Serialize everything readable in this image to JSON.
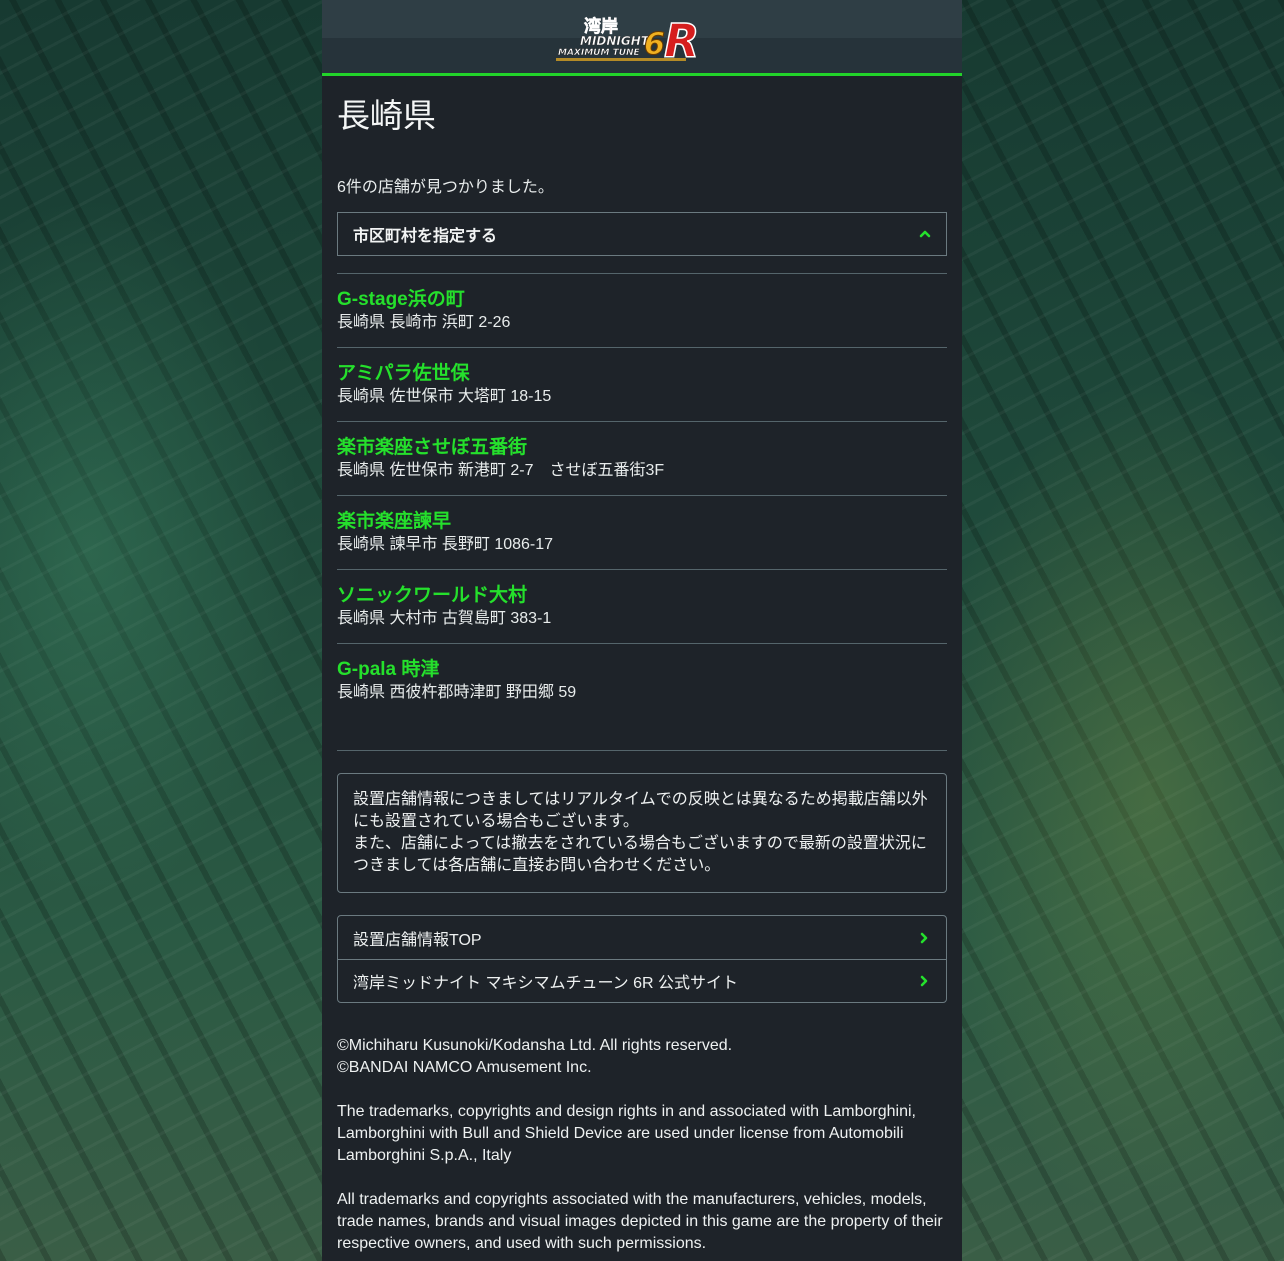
{
  "header": {
    "logo_text_top": "湾岸",
    "logo_text_mid": "MIDNIGHT",
    "logo_text_bottom": "MAXIMUM TUNE",
    "logo_letters": "6R"
  },
  "page": {
    "title": "長崎県",
    "result_count": "6件の店舗が見つかりました。",
    "city_filter_label": "市区町村を指定する"
  },
  "stores": [
    {
      "name": "G-stage浜の町",
      "address": "長崎県 長崎市 浜町 2-26"
    },
    {
      "name": "アミパラ佐世保",
      "address": "長崎県 佐世保市 大塔町 18-15"
    },
    {
      "name": "楽市楽座させぼ五番街",
      "address": "長崎県 佐世保市 新港町 2-7　させぼ五番街3F"
    },
    {
      "name": "楽市楽座諫早",
      "address": "長崎県 諫早市 長野町 1086-17"
    },
    {
      "name": "ソニックワールド大村",
      "address": "長崎県 大村市 古賀島町 383-1"
    },
    {
      "name": "G-pala 時津",
      "address": "長崎県 西彼杵郡時津町 野田郷 59"
    }
  ],
  "notice": {
    "line1": "設置店舗情報につきましてはリアルタイムでの反映とは異なるため掲載店舗以外にも設置されている場合もございます。",
    "line2": "また、店舗によっては撤去をされている場合もございますので最新の設置状況につきましては各店舗に直接お問い合わせください。"
  },
  "links": [
    {
      "label": "設置店舗情報TOP"
    },
    {
      "label": "湾岸ミッドナイト マキシマムチューン 6R 公式サイト"
    }
  ],
  "footer": {
    "copyright1": "©Michiharu Kusunoki/Kodansha Ltd. All rights reserved.",
    "copyright2": "©BANDAI NAMCO Amusement Inc.",
    "lamborghini": "The trademarks, copyrights and design rights in and associated with Lamborghini, Lamborghini with Bull and Shield Device are used under license from Automobili Lamborghini S.p.A., Italy",
    "trademarks": "All trademarks and copyrights associated with the manufacturers, vehicles, models, trade names, brands and visual images depicted in this game are the property of their respective owners, and used with such permissions."
  },
  "colors": {
    "accent": "#25e02c",
    "panel": "#1e2329",
    "border": "#55656b"
  }
}
